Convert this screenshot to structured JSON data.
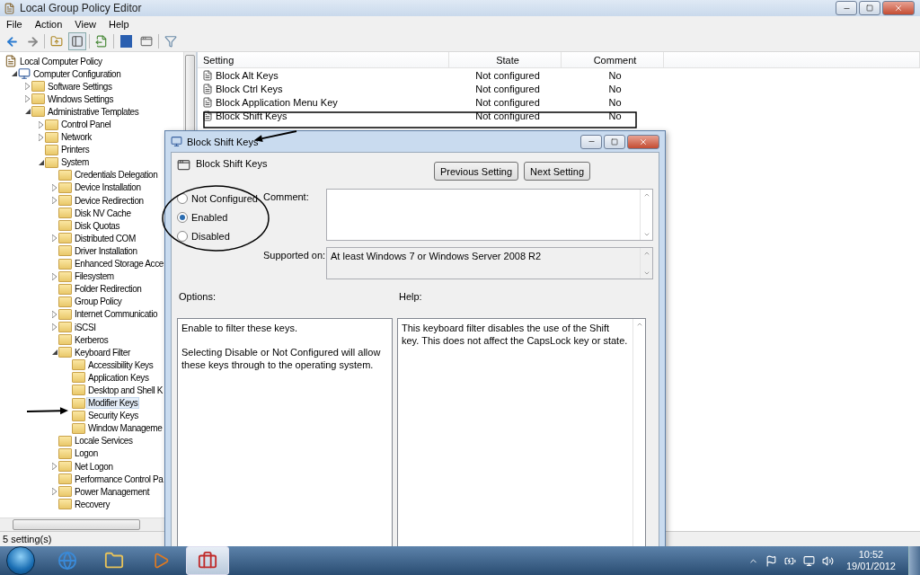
{
  "window": {
    "title": "Local Group Policy Editor"
  },
  "menu": [
    "File",
    "Action",
    "View",
    "Help"
  ],
  "tree": [
    {
      "label": "Local Computer Policy",
      "selected": false,
      "children": [
        {
          "label": "Computer Configuration",
          "kind": "expanded",
          "selected": false,
          "children": [
            {
              "label": "Software Settings",
              "kind": "collapsed",
              "selected": false
            },
            {
              "label": "Windows Settings",
              "kind": "collapsed",
              "selected": false
            },
            {
              "label": "Administrative Templates",
              "kind": "expanded",
              "selected": false,
              "children": [
                {
                  "label": "Control Panel",
                  "kind": "collapsed",
                  "selected": false
                },
                {
                  "label": "Network",
                  "kind": "collapsed",
                  "selected": false
                },
                {
                  "label": "Printers",
                  "kind": "leaf",
                  "selected": false
                },
                {
                  "label": "System",
                  "kind": "expanded",
                  "selected": false,
                  "children": [
                    {
                      "label": "Credentials Delegation",
                      "kind": "leaf",
                      "selected": false
                    },
                    {
                      "label": "Device Installation",
                      "kind": "collapsed",
                      "selected": false
                    },
                    {
                      "label": "Device Redirection",
                      "kind": "collapsed",
                      "selected": false
                    },
                    {
                      "label": "Disk NV Cache",
                      "kind": "leaf",
                      "selected": false
                    },
                    {
                      "label": "Disk Quotas",
                      "kind": "leaf",
                      "selected": false
                    },
                    {
                      "label": "Distributed COM",
                      "kind": "collapsed",
                      "selected": false
                    },
                    {
                      "label": "Driver Installation",
                      "kind": "leaf",
                      "selected": false
                    },
                    {
                      "label": "Enhanced Storage Acce",
                      "kind": "leaf",
                      "selected": false
                    },
                    {
                      "label": "Filesystem",
                      "kind": "collapsed",
                      "selected": false
                    },
                    {
                      "label": "Folder Redirection",
                      "kind": "leaf",
                      "selected": false
                    },
                    {
                      "label": "Group Policy",
                      "kind": "leaf",
                      "selected": false
                    },
                    {
                      "label": "Internet Communicatio",
                      "kind": "collapsed",
                      "selected": false
                    },
                    {
                      "label": "iSCSI",
                      "kind": "collapsed",
                      "selected": false
                    },
                    {
                      "label": "Kerberos",
                      "kind": "leaf",
                      "selected": false
                    },
                    {
                      "label": "Keyboard Filter",
                      "kind": "expanded",
                      "selected": false,
                      "children": [
                        {
                          "label": "Accessibility Keys",
                          "kind": "leaf",
                          "selected": false
                        },
                        {
                          "label": "Application Keys",
                          "kind": "leaf",
                          "selected": false
                        },
                        {
                          "label": "Desktop and Shell K",
                          "kind": "leaf",
                          "selected": false
                        },
                        {
                          "label": "Modifier Keys",
                          "kind": "leaf",
                          "selected": true
                        },
                        {
                          "label": "Security Keys",
                          "kind": "leaf",
                          "selected": false
                        },
                        {
                          "label": "Window Manageme",
                          "kind": "leaf",
                          "selected": false
                        }
                      ]
                    },
                    {
                      "label": "Locale Services",
                      "kind": "leaf",
                      "selected": false
                    },
                    {
                      "label": "Logon",
                      "kind": "leaf",
                      "selected": false
                    },
                    {
                      "label": "Net Logon",
                      "kind": "collapsed",
                      "selected": false
                    },
                    {
                      "label": "Performance Control Pa",
                      "kind": "leaf",
                      "selected": false
                    },
                    {
                      "label": "Power Management",
                      "kind": "collapsed",
                      "selected": false
                    },
                    {
                      "label": "Recovery",
                      "kind": "leaf",
                      "selected": false
                    }
                  ]
                }
              ]
            }
          ]
        }
      ]
    }
  ],
  "list": {
    "columns": [
      "Setting",
      "State",
      "Comment"
    ],
    "rows": [
      {
        "setting": "Block Alt Keys",
        "state": "Not configured",
        "comment": "No",
        "selected": false
      },
      {
        "setting": "Block Ctrl Keys",
        "state": "Not configured",
        "comment": "No",
        "selected": false
      },
      {
        "setting": "Block Application Menu Key",
        "state": "Not configured",
        "comment": "No",
        "selected": false
      },
      {
        "setting": "Block Shift Keys",
        "state": "Not configured",
        "comment": "No",
        "selected": false
      }
    ]
  },
  "dialog": {
    "title": "Block Shift Keys",
    "policy_name": "Block Shift Keys",
    "buttons": [
      "Previous Setting",
      "Next Setting"
    ],
    "options": [
      {
        "label": "Not Configured",
        "selected": false
      },
      {
        "label": "Enabled",
        "selected": true
      },
      {
        "label": "Disabled",
        "selected": false
      }
    ],
    "comment_label": "Comment:",
    "supported_on_label": "Supported on:",
    "supported_on": "At least Windows 7 or Windows Server 2008 R2",
    "options_label": "Options:",
    "help_label": "Help:",
    "options_text": [
      "Enable to filter these keys.",
      "Selecting Disable or Not Configured will allow these keys through to the operating system."
    ],
    "help_text": "This keyboard filter disables the use of the Shift key. This does not affect the CapsLock key or state."
  },
  "status_bar": "5 setting(s)",
  "taskbar": {
    "apps": [
      {
        "kind": "browser",
        "selected": false
      },
      {
        "kind": "folder",
        "selected": false
      },
      {
        "kind": "media",
        "selected": false
      },
      {
        "kind": "toolbox",
        "selected": true
      }
    ],
    "time": "10:52",
    "date": "19/01/2012"
  }
}
